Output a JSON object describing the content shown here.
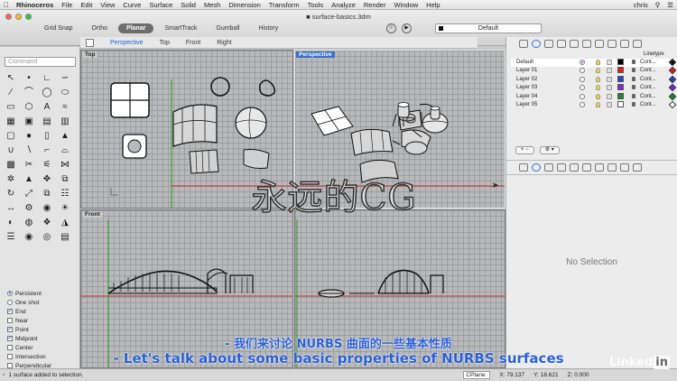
{
  "menubar": {
    "app_name": "Rhinoceros",
    "items": [
      "File",
      "Edit",
      "View",
      "Curve",
      "Surface",
      "Solid",
      "Mesh",
      "Dimension",
      "Transform",
      "Tools",
      "Analyze",
      "Render",
      "Window",
      "Help"
    ],
    "user": "chris"
  },
  "window": {
    "title": "surface-basics.3dm"
  },
  "toolbar": {
    "toggles": [
      "Grid Snap",
      "Ortho",
      "Planar",
      "SmartTrack",
      "Gumball",
      "History"
    ],
    "active_toggle": "Planar",
    "current_layer": "Default"
  },
  "viewport_tabs": {
    "items": [
      "Perspective",
      "Top",
      "Front",
      "Right"
    ],
    "active": "Perspective"
  },
  "command": {
    "placeholder": "Command"
  },
  "viewports": {
    "top": "Top",
    "perspective": "Perspective",
    "front": "Front",
    "right": ""
  },
  "layers": {
    "header_linetype": "Linetype",
    "rows": [
      {
        "name": "Default",
        "color": "#000000",
        "linetype": "Cont...",
        "current": true,
        "marker": "#111111"
      },
      {
        "name": "Layer 01",
        "color": "#e01e1e",
        "linetype": "Cont...",
        "current": false,
        "marker": "#e01e1e"
      },
      {
        "name": "Layer 02",
        "color": "#2a3fd6",
        "linetype": "Cont...",
        "current": false,
        "marker": "#2a3fd6"
      },
      {
        "name": "Layer 03",
        "color": "#7a2ad6",
        "linetype": "Cont...",
        "current": false,
        "marker": "#7a2ad6"
      },
      {
        "name": "Layer 04",
        "color": "#1a8a2a",
        "linetype": "Cont...",
        "current": false,
        "marker": "#1a8a2a"
      },
      {
        "name": "Layer 05",
        "color": "#ffffff",
        "linetype": "Cont...",
        "current": false,
        "marker": "#ffffff"
      }
    ]
  },
  "properties": {
    "empty_text": "No Selection"
  },
  "osnaps": [
    {
      "label": "Persistent",
      "type": "radio",
      "checked": true
    },
    {
      "label": "One shot",
      "type": "radio",
      "checked": false
    },
    {
      "label": "End",
      "type": "check",
      "checked": true
    },
    {
      "label": "Near",
      "type": "check",
      "checked": false
    },
    {
      "label": "Point",
      "type": "check",
      "checked": true
    },
    {
      "label": "Midpoint",
      "type": "check",
      "checked": true
    },
    {
      "label": "Center",
      "type": "check",
      "checked": false
    },
    {
      "label": "Intersection",
      "type": "check",
      "checked": false
    },
    {
      "label": "Perpendicular",
      "type": "check",
      "checked": false
    }
  ],
  "status": {
    "message": "1 surface added to selection.",
    "cplane": "CPlane",
    "x": "X: 79.137",
    "y": "Y: 18.621",
    "z": "Z: 0.000"
  },
  "overlay": {
    "watermark_cn": "永远的CG",
    "subtitle_cn": "- 我们来讨论 NURBS 曲面的一些基本性质",
    "subtitle_en": "- Let's talk about some basic properties of NURBS surfaces",
    "brand": "Linked",
    "brand_in": "in"
  },
  "colors": {
    "accent": "#1f5fd1",
    "subtitle": "#2a5fd6",
    "viewport_bg": "#b7b9ba"
  }
}
